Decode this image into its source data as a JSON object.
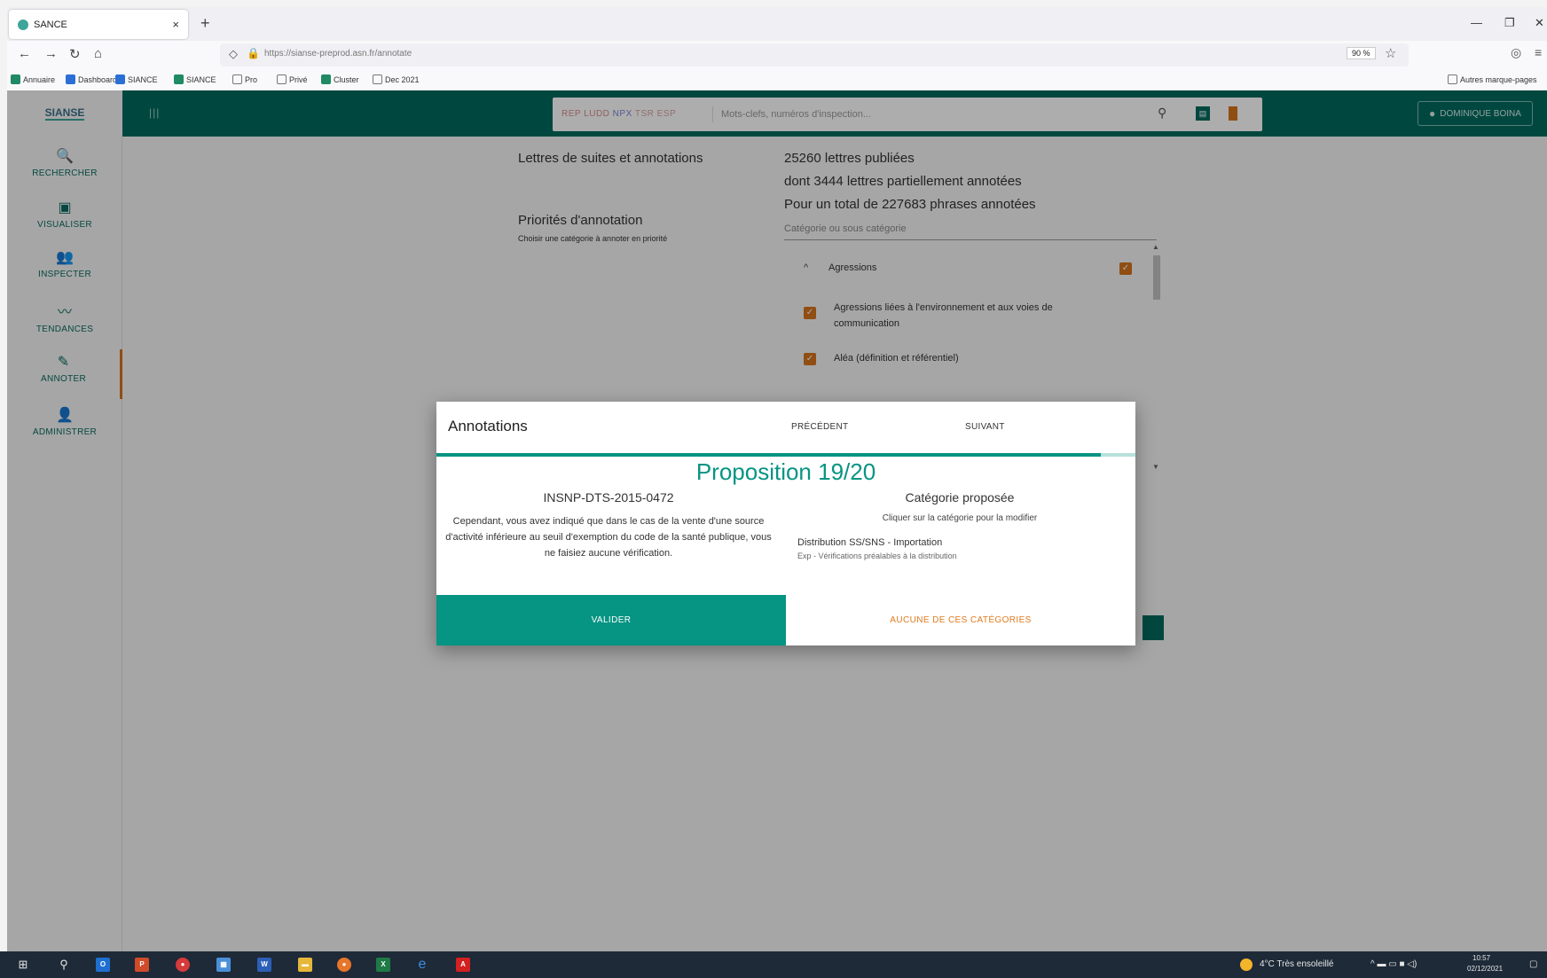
{
  "browser": {
    "tab_title": "SANCE",
    "tab_close": "×",
    "new_tab": "+",
    "url": "https://sianse-preprod.asn.fr/annotate",
    "zoom": "90 %",
    "window_controls": [
      "—",
      "❐",
      "✕"
    ],
    "bookmarks": [
      "Annuaire",
      "Dashboard",
      "SIANCE",
      "SIANCE",
      "Pro",
      "Privé",
      "Cluster",
      "Dec 2021"
    ],
    "other_bookmarks": "Autres marque-pages"
  },
  "app": {
    "logo": "SIANSE",
    "search": {
      "code_red": "REP LUDD",
      "code_blue": "NPX",
      "code_pink": "TSR ESP",
      "placeholder": "Mots-clefs, numéros d'inspection..."
    },
    "user": "DOMINIQUE BOINA",
    "sidebar": [
      {
        "icon": "search-icon",
        "glyph": "🔍",
        "label": "RECHERCHER"
      },
      {
        "icon": "chart-icon",
        "glyph": "▣",
        "label": "VISUALISER"
      },
      {
        "icon": "inspect-icon",
        "glyph": "👥",
        "label": "INSPECTER"
      },
      {
        "icon": "trend-icon",
        "glyph": "〰",
        "label": "TENDANCES"
      },
      {
        "icon": "pencil-icon",
        "glyph": "✎",
        "label": "ANNOTER"
      },
      {
        "icon": "admin-icon",
        "glyph": "👤",
        "label": "ADMINISTRER"
      }
    ],
    "main": {
      "letters_label": "Lettres de suites et annotations",
      "stats": [
        "25260 lettres publiées",
        "dont 3444 lettres partiellement annotées",
        "Pour un total de 227683 phrases annotées"
      ],
      "priorities_label": "Priorités d'annotation",
      "priorities_hint": "Choisir une catégorie à annoter en priorité",
      "category_placeholder": "Catégorie ou sous catégorie",
      "categories": [
        {
          "label": "Agressions",
          "checked": true,
          "chevron": "^"
        },
        {
          "label": "Agressions liées à l'environnement et aux voies de communication",
          "checked": true
        },
        {
          "label": "Aléa (définition et référentiel)",
          "checked": true
        }
      ]
    }
  },
  "dialog": {
    "title": "Annotations",
    "prev": "PRÉCÉDENT",
    "next": "SUIVANT",
    "proposition": "Proposition 19/20",
    "progress": 0.95,
    "code": "INSNP-DTS-2015-0472",
    "sentence": "Cependant, vous avez indiqué que dans le cas de la vente d'une source d'activité inférieure au seuil d'exemption du code de la santé publique, vous ne faisiez aucune vérification.",
    "cat_title": "Catégorie proposée",
    "cat_hint": "Cliquer sur la catégorie pour la modifier",
    "category": "Distribution SS/SNS - Importation",
    "subcategory": "Exp - Vérifications préalables à la distribution",
    "validate": "VALIDER",
    "none": "AUCUNE DE CES CATÉGORIES"
  },
  "taskbar": {
    "weather": "4°C  Très ensoleillé",
    "time": "10:57",
    "date": "02/12/2021"
  }
}
